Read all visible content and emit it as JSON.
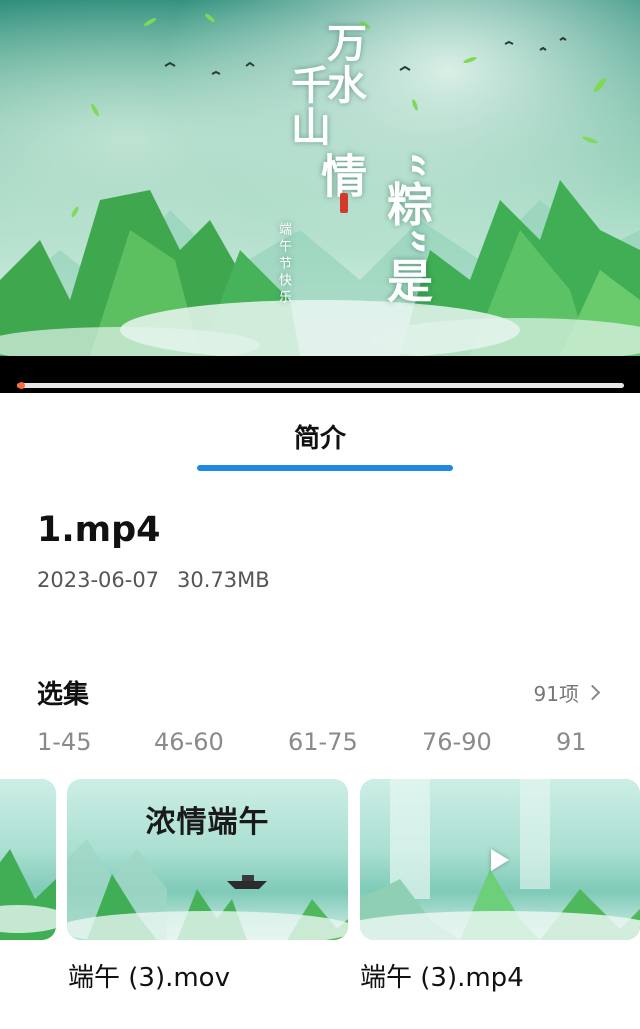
{
  "player": {
    "poster_text": {
      "line1": "万水",
      "line2": "千山",
      "line3": "“粽”是情",
      "subtitle": "端午节快乐"
    },
    "progress": 0.004
  },
  "tabs": {
    "active_label": "简介"
  },
  "file": {
    "name": "1.mp4",
    "date": "2023-06-07",
    "size": "30.73MB"
  },
  "episodes": {
    "title": "选集",
    "count": "91项",
    "ranges": [
      "1-45",
      "46-60",
      "61-75",
      "76-90",
      "91"
    ],
    "items": [
      {
        "label": "",
        "thumb_title": ""
      },
      {
        "label": "端午 (3).mov",
        "thumb_title": "浓情端午"
      },
      {
        "label": "端午 (3).mp4",
        "thumb_title": ""
      }
    ]
  },
  "colors": {
    "accent": "#1e88e5",
    "progress": "#ff7a45"
  }
}
